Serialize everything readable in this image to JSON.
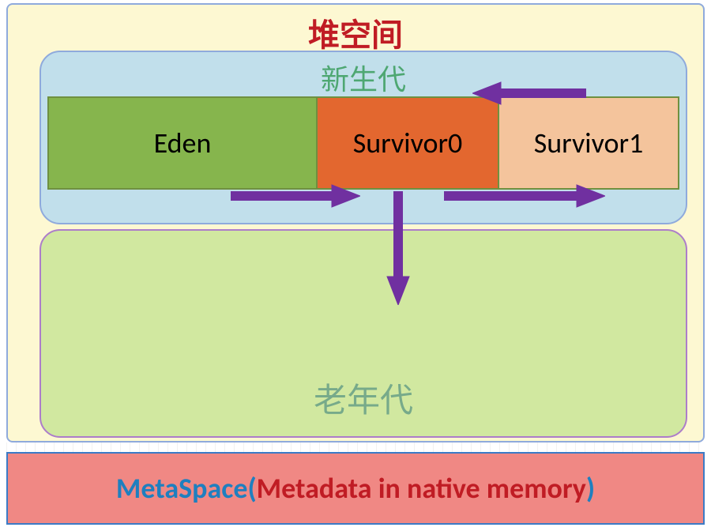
{
  "heap": {
    "title": "堆空间",
    "young": {
      "title": "新生代",
      "eden_label": "Eden",
      "s0_label": "Survivor0",
      "s1_label": "Survivor1"
    },
    "old": {
      "title": "老年代"
    }
  },
  "metaspace": {
    "prefix": "MetaSpace",
    "paren_open": "(",
    "body": "Metadata in native memory",
    "paren_close": ")"
  },
  "arrows": [
    {
      "name": "eden-to-s0",
      "from": "Eden",
      "to": "Survivor0"
    },
    {
      "name": "s0-to-s1",
      "from": "Survivor0",
      "to": "Survivor1"
    },
    {
      "name": "s1-to-s0",
      "from": "Survivor1",
      "to": "Survivor0"
    },
    {
      "name": "young-to-old",
      "from": "Survivor0",
      "to": "老年代"
    }
  ],
  "colors": {
    "heap_bg": "#fdf8d2",
    "young_bg": "#c1dfeb",
    "eden_bg": "#86b54d",
    "s0_bg": "#e3672f",
    "s1_bg": "#f4c49c",
    "old_bg": "#d1e8a0",
    "meta_bg": "#f08884",
    "arrow": "#7030a0",
    "title_red": "#c01c24",
    "title_green": "#4ea772",
    "meta_blue": "#1f7fbf"
  }
}
